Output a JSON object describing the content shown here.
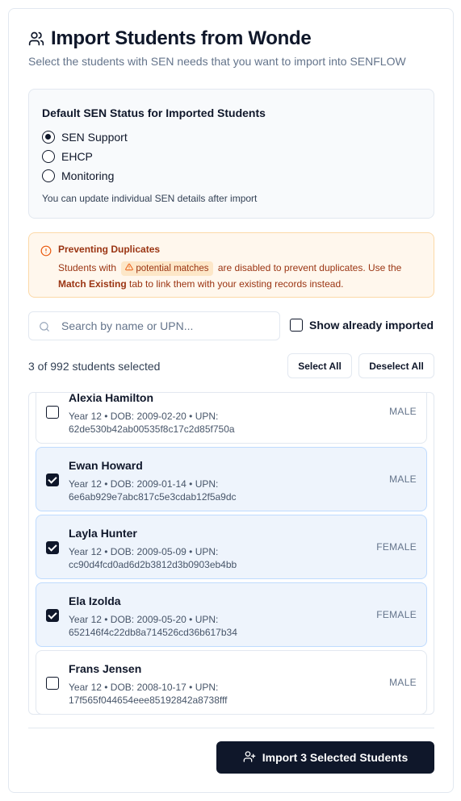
{
  "header": {
    "title": "Import Students from Wonde",
    "subtitle": "Select the students with SEN needs that you want to import into SENFLOW"
  },
  "sen_status": {
    "title": "Default SEN Status for Imported Students",
    "options": [
      {
        "label": "SEN Support",
        "checked": true
      },
      {
        "label": "EHCP",
        "checked": false
      },
      {
        "label": "Monitoring",
        "checked": false
      }
    ],
    "hint": "You can update individual SEN details after import"
  },
  "duplicates": {
    "title": "Preventing Duplicates",
    "text_1": "Students with",
    "pill_label": "potential matches",
    "text_2": "are disabled to prevent duplicates. Use the",
    "bold_label": "Match Existing",
    "text_3": "tab to link them with your existing records instead."
  },
  "search": {
    "placeholder": "Search by name or UPN..."
  },
  "show_imported": {
    "label": "Show already imported",
    "checked": false
  },
  "selection": {
    "count_text": "3 of 992 students selected",
    "select_all": "Select All",
    "deselect_all": "Deselect All"
  },
  "students": [
    {
      "name": "Alexia Hamilton",
      "meta": "Year 12 • DOB: 2009-02-20 • UPN: 62de530b42ab00535f8c17c2d85f750a",
      "gender": "MALE",
      "selected": false
    },
    {
      "name": "Ewan Howard",
      "meta": "Year 12 • DOB: 2009-01-14 • UPN: 6e6ab929e7abc817c5e3cdab12f5a9dc",
      "gender": "MALE",
      "selected": true
    },
    {
      "name": "Layla Hunter",
      "meta": "Year 12 • DOB: 2009-05-09 • UPN: cc90d4fcd0ad6d2b3812d3b0903eb4bb",
      "gender": "FEMALE",
      "selected": true
    },
    {
      "name": "Ela Izolda",
      "meta": "Year 12 • DOB: 2009-05-20 • UPN: 652146f4c22db8a714526cd36b617b34",
      "gender": "FEMALE",
      "selected": true
    },
    {
      "name": "Frans Jensen",
      "meta": "Year 12 • DOB: 2008-10-17 • UPN: 17f565f044654eee85192842a8738fff",
      "gender": "MALE",
      "selected": false
    }
  ],
  "footer": {
    "import_label": "Import 3 Selected Students"
  },
  "icons": {
    "header": "users-icon",
    "warning": "alert-circle-icon",
    "pill": "alert-triangle-icon",
    "search": "search-icon",
    "import": "user-plus-icon"
  },
  "colors": {
    "primary": "#0f172a",
    "warning_bg": "#fff7ed",
    "warning_text": "#9a3412",
    "selected_bg": "#eef4fc"
  }
}
